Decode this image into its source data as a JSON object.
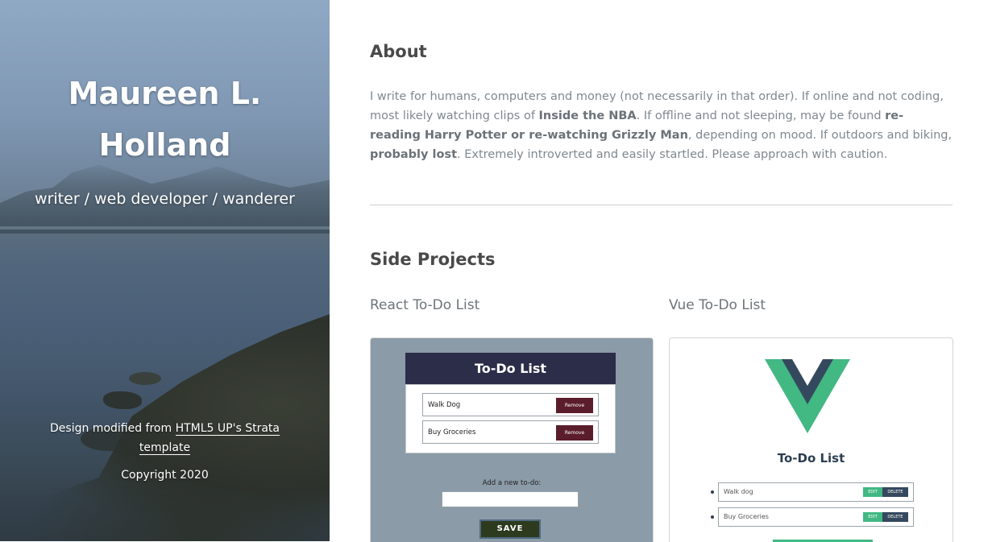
{
  "hero": {
    "name_line1": "Maureen L.",
    "name_line2": "Holland",
    "tagline": "writer / web developer / wanderer",
    "footer_prefix": "Design modified from ",
    "footer_link": "HTML5 UP's Strata template",
    "copyright": "Copyright 2020"
  },
  "about": {
    "title": "About",
    "p1": "I write for humans, computers and money (not necessarily in that order). If online and not coding, most likely watching clips of ",
    "b1": "Inside the NBA",
    "p2": ". If offline and not sleeping, may be found ",
    "b2": "re-reading Harry Potter or re-watching Grizzly Man",
    "p3": ", depending on mood. If outdoors and biking, ",
    "b3": "probably lost",
    "p4": ". Extremely introverted and easily startled. Please approach with caution."
  },
  "projects": {
    "title": "Side Projects",
    "react": {
      "label": "React To-Do List",
      "app_title": "To-Do List",
      "items": [
        {
          "text": "Walk Dog",
          "button": "Remove"
        },
        {
          "text": "Buy Groceries",
          "button": "Remove"
        }
      ],
      "add_label": "Add a new to-do:",
      "save": "SAVE"
    },
    "vue": {
      "label": "Vue To-Do List",
      "app_title": "To-Do List",
      "items": [
        {
          "text": "Walk dog",
          "edit": "EDIT",
          "delete": "DELETE"
        },
        {
          "text": "Buy Groceries",
          "edit": "EDIT",
          "delete": "DELETE"
        }
      ]
    }
  },
  "colors": {
    "heading": "#494949",
    "body_text": "#7f888f",
    "react_header": "#2c2d49",
    "react_remove": "#5b1d2b",
    "vue_green": "#42b883",
    "vue_navy": "#35495e"
  },
  "icons": {
    "vue_logo": "vue-logo-icon"
  }
}
